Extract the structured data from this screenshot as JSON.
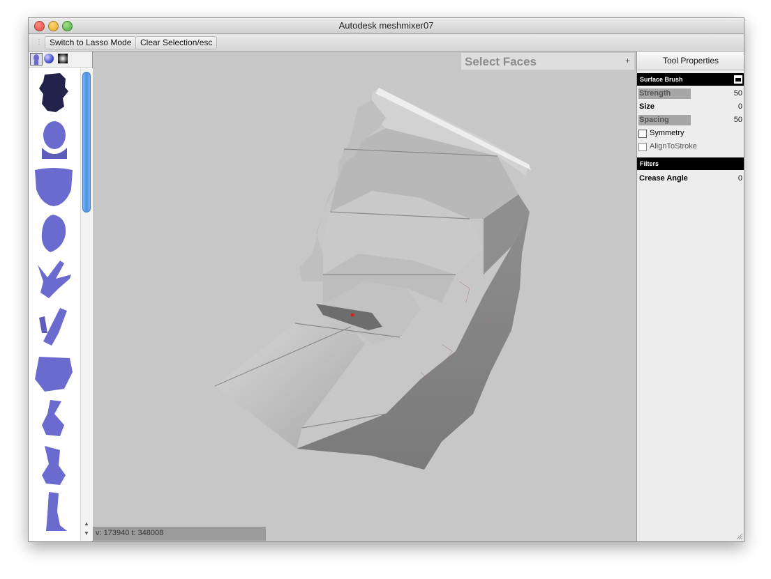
{
  "window": {
    "title": "Autodesk meshmixer07"
  },
  "toolbar": {
    "lasso_label": "Switch to Lasso Mode",
    "clear_label": "Clear Selection/esc"
  },
  "left_panel": {
    "thumbnails": [
      "head-scan",
      "bust",
      "face",
      "ear",
      "hand-peace",
      "arm",
      "torso",
      "foot",
      "foot-side",
      "leg"
    ]
  },
  "viewport": {
    "select_faces_label": "Select Faces",
    "expand_symbol": "+",
    "status": "v: 173940  t: 348008"
  },
  "tool_properties": {
    "header": "Tool Properties",
    "surface_brush": {
      "title": "Surface Brush",
      "strength": {
        "label": "Strength",
        "value": "50"
      },
      "size": {
        "label": "Size",
        "value": "0"
      },
      "spacing": {
        "label": "Spacing",
        "value": "50"
      },
      "symmetry": {
        "label": "Symmetry"
      },
      "align_to_stroke": {
        "label": "AlignToStroke"
      }
    },
    "filters": {
      "title": "Filters",
      "crease_angle": {
        "label": "Crease Angle",
        "value": "0"
      }
    }
  },
  "colors": {
    "mesh": "#a9a9a9",
    "thumbnail": "#6b6bcf",
    "viewport_bg": "#c7c7c7",
    "accent_scroll": "#4a8fe0"
  }
}
